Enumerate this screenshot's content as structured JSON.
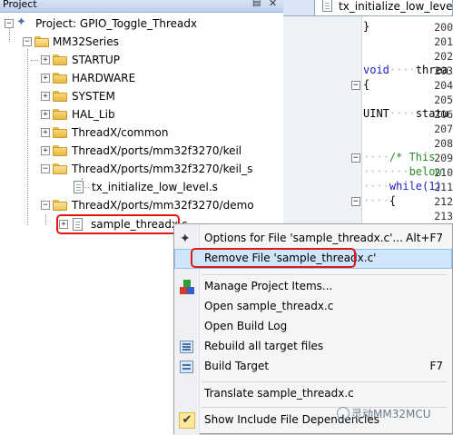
{
  "project_panel": {
    "title": "Project",
    "pin_icon": "pin-icon",
    "close_icon": "close-icon",
    "tree": {
      "root": "Project: GPIO_Toggle_Threadx",
      "target": "MM32Series",
      "groups": [
        "STARTUP",
        "HARDWARE",
        "SYSTEM",
        "HAL_Lib",
        "ThreadX/common",
        "ThreadX/ports/mm32f3270/keil",
        "ThreadX/ports/mm32f3270/keil_s",
        "ThreadX/ports/mm32f3270/demo"
      ],
      "keil_s_file": "tx_initialize_low_level.s",
      "demo_file": "sample_threadx.c"
    }
  },
  "editor": {
    "tab_label": "tx_initialize_low_level.s",
    "line_numbers": [
      "200",
      "201",
      "202",
      "203",
      "204",
      "205",
      "206",
      "207",
      "208",
      "209",
      "210",
      "211",
      "212",
      "213"
    ],
    "code": {
      "l200": "}",
      "l203_kw": "void",
      "l203_rest": "threa",
      "l204": "{",
      "l206_a": "UINT",
      "l206_b": "statu",
      "l209": "/* This",
      "l210": "below",
      "l211_kw": "while(1)",
      "l212": "{"
    }
  },
  "context_menu": {
    "items": {
      "options": {
        "label": "Options for File 'sample_threadx.c'...",
        "shortcut": "Alt+F7"
      },
      "remove": {
        "label": "Remove File 'sample_threadx.c'"
      },
      "manage": {
        "label": "Manage Project Items..."
      },
      "open": {
        "label": "Open sample_threadx.c"
      },
      "open_build_log": {
        "label": "Open Build Log"
      },
      "rebuild": {
        "label": "Rebuild all target files"
      },
      "build": {
        "label": "Build Target",
        "shortcut": "F7"
      },
      "translate": {
        "label": "Translate sample_threadx.c"
      },
      "show_include": {
        "label": "Show Include File Dependencies"
      }
    }
  },
  "watermark": "灵动MM32MCU",
  "colors": {
    "highlight_outline": "#e01818",
    "menu_hover": "#cfe5fb",
    "keyword": "#1e22c8",
    "comment": "#2a8a2a"
  }
}
